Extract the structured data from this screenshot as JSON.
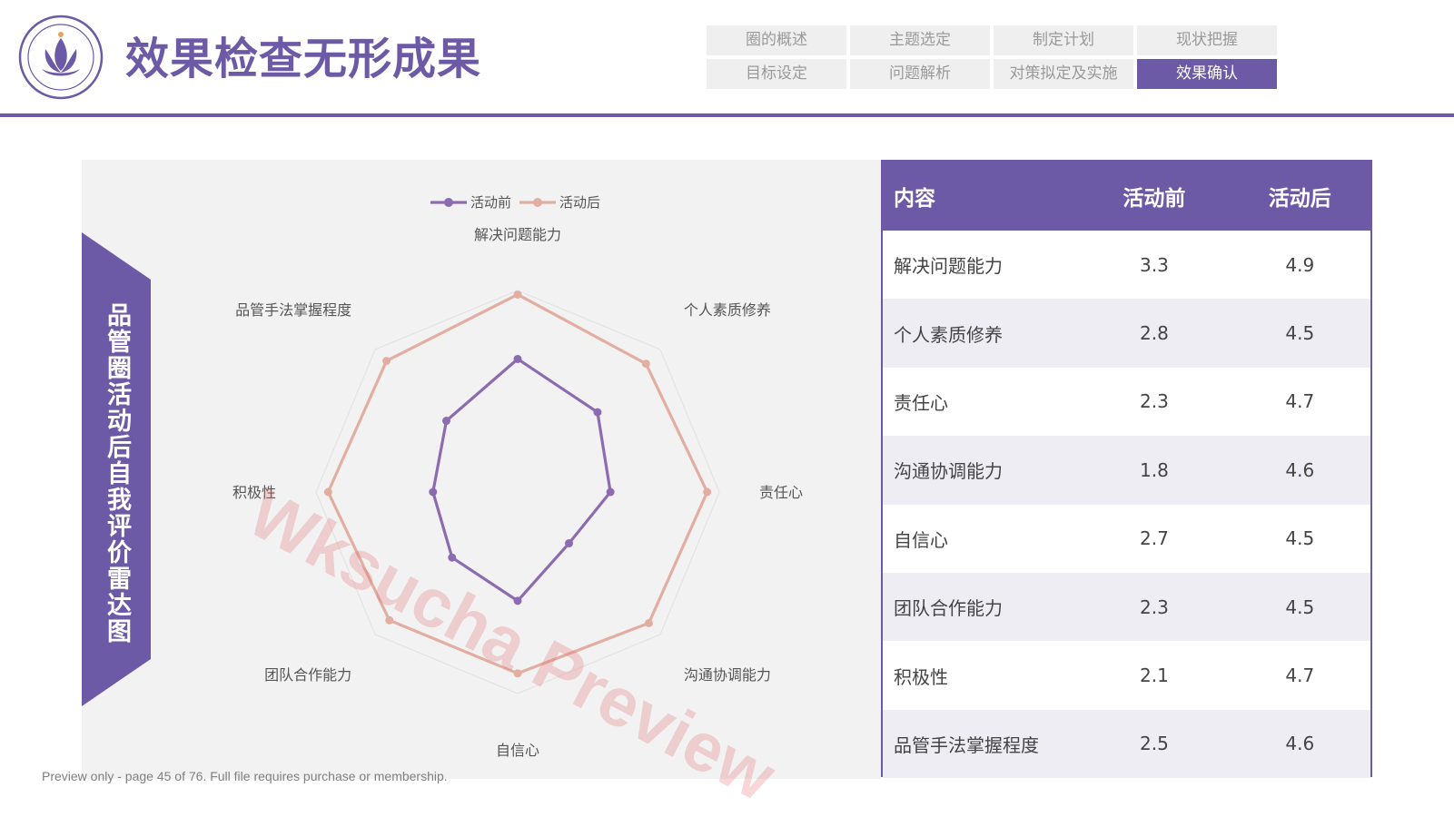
{
  "header": {
    "title": "效果检查无形成果",
    "logo_name": "logo-seal"
  },
  "nav": {
    "items": [
      {
        "label": "圈的概述"
      },
      {
        "label": "主题选定"
      },
      {
        "label": "制定计划"
      },
      {
        "label": "现状把握"
      },
      {
        "label": "目标设定"
      },
      {
        "label": "问题解析"
      },
      {
        "label": "对策拟定及实施"
      },
      {
        "label": "效果确认"
      }
    ],
    "active_index": 7
  },
  "side_label": "品管圈活动后自我评价雷达图",
  "colors": {
    "accent": "#6c5aa6",
    "before": "#8d6bb1",
    "after": "#e2aea2"
  },
  "chart_data": {
    "type": "radar",
    "categories": [
      "解决问题能力",
      "个人素质修养",
      "责任心",
      "沟通协调能力",
      "自信心",
      "团队合作能力",
      "积极性",
      "品管手法掌握程度"
    ],
    "series": [
      {
        "name": "活动前",
        "values": [
          3.3,
          2.8,
          2.3,
          1.8,
          2.7,
          2.3,
          2.1,
          2.5
        ]
      },
      {
        "name": "活动后",
        "values": [
          4.9,
          4.5,
          4.7,
          4.6,
          4.5,
          4.5,
          4.7,
          4.6
        ]
      }
    ],
    "rmax": 5,
    "legend_position": "top"
  },
  "table": {
    "headers": [
      "内容",
      "活动前",
      "活动后"
    ],
    "rows": [
      [
        "解决问题能力",
        "3.3",
        "4.9"
      ],
      [
        "个人素质修养",
        "2.8",
        "4.5"
      ],
      [
        "责任心",
        "2.3",
        "4.7"
      ],
      [
        "沟通协调能力",
        "1.8",
        "4.6"
      ],
      [
        "自信心",
        "2.7",
        "4.5"
      ],
      [
        "团队合作能力",
        "2.3",
        "4.5"
      ],
      [
        "积极性",
        "2.1",
        "4.7"
      ],
      [
        "品管手法掌握程度",
        "2.5",
        "4.6"
      ]
    ]
  },
  "watermark": "Wksucha Preview",
  "footer": "Preview only - page 45 of 76. Full file requires purchase or membership."
}
